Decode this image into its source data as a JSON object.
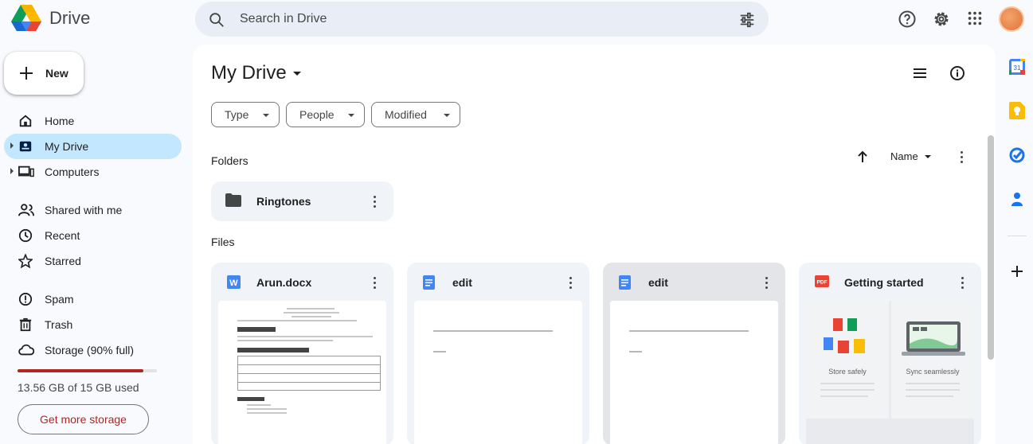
{
  "app": {
    "name": "Drive"
  },
  "search": {
    "placeholder": "Search in Drive"
  },
  "sidebar": {
    "new_label": "New",
    "items": [
      {
        "label": "Home",
        "icon": "home-icon"
      },
      {
        "label": "My Drive",
        "icon": "my-drive-icon",
        "active": true
      },
      {
        "label": "Computers",
        "icon": "computers-icon"
      },
      {
        "label": "Shared with me",
        "icon": "shared-icon"
      },
      {
        "label": "Recent",
        "icon": "clock-icon"
      },
      {
        "label": "Starred",
        "icon": "star-icon"
      },
      {
        "label": "Spam",
        "icon": "spam-icon"
      },
      {
        "label": "Trash",
        "icon": "trash-icon"
      },
      {
        "label": "Storage (90% full)",
        "icon": "cloud-icon"
      }
    ],
    "storage_used_fraction": 0.9,
    "storage_text": "13.56 GB of 15 GB used",
    "get_storage_label": "Get more storage"
  },
  "main": {
    "title": "My Drive",
    "filters": [
      "Type",
      "People",
      "Modified"
    ],
    "folders_label": "Folders",
    "sort_label": "Name",
    "folders": [
      {
        "name": "Ringtones"
      }
    ],
    "files_label": "Files",
    "files": [
      {
        "name": "Arun.docx",
        "type": "word"
      },
      {
        "name": "edit",
        "type": "docs"
      },
      {
        "name": "edit",
        "type": "docs"
      },
      {
        "name": "Getting started",
        "type": "pdf"
      }
    ],
    "pdf_thumb": {
      "left_caption": "Store safely",
      "right_caption": "Sync seamlessly"
    }
  },
  "colors": {
    "accent": "#c2e7ff",
    "storage_warning": "#b3261e",
    "docs_blue": "#4285f4"
  }
}
